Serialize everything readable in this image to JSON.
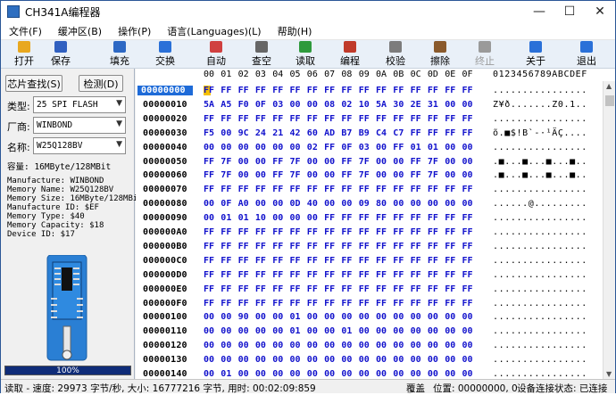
{
  "window": {
    "title": "CH341A编程器",
    "minimize": "—",
    "maximize": "☐",
    "close": "✕"
  },
  "menu": [
    "文件(F)",
    "缓冲区(B)",
    "操作(P)",
    "语言(Languages)(L)",
    "帮助(H)"
  ],
  "toolbar": [
    {
      "label": "打开",
      "icon": "open-folder-icon",
      "color": "#e8a820",
      "disabled": false
    },
    {
      "label": "保存",
      "icon": "save-disk-icon",
      "color": "#3060c0",
      "disabled": false
    },
    {
      "label": "填充",
      "icon": "fill-pen-icon",
      "color": "#2d68c4",
      "disabled": false
    },
    {
      "label": "交换",
      "icon": "swap-arrows-icon",
      "color": "#2a70d8",
      "disabled": false
    },
    {
      "label": "自动",
      "icon": "auto-run-icon",
      "color": "#d04040",
      "disabled": false
    },
    {
      "label": "查空",
      "icon": "blank-check-icon",
      "color": "#666666",
      "disabled": false
    },
    {
      "label": "读取",
      "icon": "read-chip-icon",
      "color": "#2e9a3c",
      "disabled": false
    },
    {
      "label": "编程",
      "icon": "program-chip-icon",
      "color": "#c03a2a",
      "disabled": false
    },
    {
      "label": "校验",
      "icon": "verify-icon",
      "color": "#7c7c7c",
      "disabled": false
    },
    {
      "label": "擦除",
      "icon": "erase-icon",
      "color": "#8a5a2c",
      "disabled": false
    },
    {
      "label": "终止",
      "icon": "stop-icon",
      "color": "#9a9a9a",
      "disabled": true
    },
    {
      "label": "关于",
      "icon": "about-info-icon",
      "color": "#2a70d8",
      "disabled": false
    },
    {
      "label": "退出",
      "icon": "exit-door-icon",
      "color": "#2a70d8",
      "disabled": false
    }
  ],
  "left": {
    "find_chip_label": "芯片查找(S)",
    "detect_label": "检测(D)",
    "type_label": "类型:",
    "type_value": "25 SPI FLASH",
    "vendor_label": "厂商:",
    "vendor_value": "WINBOND",
    "name_label": "名称:",
    "name_value": "W25Q128BV",
    "capacity_text": "容量: 16MByte/128MBit",
    "info_lines": [
      "Manufacture: WINBOND",
      "Memory Name: W25Q128BV",
      "Memory Size: 16MByte/128MBi",
      "Manufacture ID: $EF",
      "Memory Type: $40",
      "Memory Capacity: $18",
      "Device ID: $17"
    ],
    "progress_text": "100%",
    "progress_value": 1.0
  },
  "hex": {
    "header_cols": [
      "00",
      "01",
      "02",
      "03",
      "04",
      "05",
      "06",
      "07",
      "08",
      "09",
      "0A",
      "0B",
      "0C",
      "0D",
      "0E",
      "0F"
    ],
    "ascii_header": "0123456789ABCDEF",
    "rows": [
      {
        "addr": "00000000",
        "bytes": [
          "FF",
          "FF",
          "FF",
          "FF",
          "FF",
          "FF",
          "FF",
          "FF",
          "FF",
          "FF",
          "FF",
          "FF",
          "FF",
          "FF",
          "FF",
          "FF"
        ],
        "ascii": "................"
      },
      {
        "addr": "00000010",
        "bytes": [
          "5A",
          "A5",
          "F0",
          "0F",
          "03",
          "00",
          "00",
          "08",
          "02",
          "10",
          "5A",
          "30",
          "2E",
          "31",
          "00",
          "00"
        ],
        "ascii": "Z¥ð.......Z0.1.."
      },
      {
        "addr": "00000020",
        "bytes": [
          "FF",
          "FF",
          "FF",
          "FF",
          "FF",
          "FF",
          "FF",
          "FF",
          "FF",
          "FF",
          "FF",
          "FF",
          "FF",
          "FF",
          "FF",
          "FF"
        ],
        "ascii": "................"
      },
      {
        "addr": "00000030",
        "bytes": [
          "F5",
          "00",
          "9C",
          "24",
          "21",
          "42",
          "60",
          "AD",
          "B7",
          "B9",
          "C4",
          "C7",
          "FF",
          "FF",
          "FF",
          "FF"
        ],
        "ascii": "õ.■$!B`-·¹ÄÇ...."
      },
      {
        "addr": "00000040",
        "bytes": [
          "00",
          "00",
          "00",
          "00",
          "00",
          "00",
          "02",
          "FF",
          "0F",
          "03",
          "00",
          "FF",
          "01",
          "01",
          "00",
          "00"
        ],
        "ascii": "................"
      },
      {
        "addr": "00000050",
        "bytes": [
          "FF",
          "7F",
          "00",
          "00",
          "FF",
          "7F",
          "00",
          "00",
          "FF",
          "7F",
          "00",
          "00",
          "FF",
          "7F",
          "00",
          "00"
        ],
        "ascii": ".■...■...■...■.."
      },
      {
        "addr": "00000060",
        "bytes": [
          "FF",
          "7F",
          "00",
          "00",
          "FF",
          "7F",
          "00",
          "00",
          "FF",
          "7F",
          "00",
          "00",
          "FF",
          "7F",
          "00",
          "00"
        ],
        "ascii": ".■...■...■...■.."
      },
      {
        "addr": "00000070",
        "bytes": [
          "FF",
          "FF",
          "FF",
          "FF",
          "FF",
          "FF",
          "FF",
          "FF",
          "FF",
          "FF",
          "FF",
          "FF",
          "FF",
          "FF",
          "FF",
          "FF"
        ],
        "ascii": "................"
      },
      {
        "addr": "00000080",
        "bytes": [
          "00",
          "0F",
          "A0",
          "00",
          "00",
          "0D",
          "40",
          "00",
          "00",
          "09",
          "80",
          "00",
          "00",
          "00",
          "00",
          "00"
        ],
        "ascii": "......@........."
      },
      {
        "addr": "00000090",
        "bytes": [
          "00",
          "01",
          "01",
          "10",
          "00",
          "00",
          "00",
          "FF",
          "FF",
          "FF",
          "FF",
          "FF",
          "FF",
          "FF",
          "FF",
          "FF"
        ],
        "ascii": "................"
      },
      {
        "addr": "000000A0",
        "bytes": [
          "FF",
          "FF",
          "FF",
          "FF",
          "FF",
          "FF",
          "FF",
          "FF",
          "FF",
          "FF",
          "FF",
          "FF",
          "FF",
          "FF",
          "FF",
          "FF"
        ],
        "ascii": "................"
      },
      {
        "addr": "000000B0",
        "bytes": [
          "FF",
          "FF",
          "FF",
          "FF",
          "FF",
          "FF",
          "FF",
          "FF",
          "FF",
          "FF",
          "FF",
          "FF",
          "FF",
          "FF",
          "FF",
          "FF"
        ],
        "ascii": "................"
      },
      {
        "addr": "000000C0",
        "bytes": [
          "FF",
          "FF",
          "FF",
          "FF",
          "FF",
          "FF",
          "FF",
          "FF",
          "FF",
          "FF",
          "FF",
          "FF",
          "FF",
          "FF",
          "FF",
          "FF"
        ],
        "ascii": "................"
      },
      {
        "addr": "000000D0",
        "bytes": [
          "FF",
          "FF",
          "FF",
          "FF",
          "FF",
          "FF",
          "FF",
          "FF",
          "FF",
          "FF",
          "FF",
          "FF",
          "FF",
          "FF",
          "FF",
          "FF"
        ],
        "ascii": "................"
      },
      {
        "addr": "000000E0",
        "bytes": [
          "FF",
          "FF",
          "FF",
          "FF",
          "FF",
          "FF",
          "FF",
          "FF",
          "FF",
          "FF",
          "FF",
          "FF",
          "FF",
          "FF",
          "FF",
          "FF"
        ],
        "ascii": "................"
      },
      {
        "addr": "000000F0",
        "bytes": [
          "FF",
          "FF",
          "FF",
          "FF",
          "FF",
          "FF",
          "FF",
          "FF",
          "FF",
          "FF",
          "FF",
          "FF",
          "FF",
          "FF",
          "FF",
          "FF"
        ],
        "ascii": "................"
      },
      {
        "addr": "00000100",
        "bytes": [
          "00",
          "00",
          "90",
          "00",
          "00",
          "01",
          "00",
          "00",
          "00",
          "00",
          "00",
          "00",
          "00",
          "00",
          "00",
          "00"
        ],
        "ascii": "................"
      },
      {
        "addr": "00000110",
        "bytes": [
          "00",
          "00",
          "00",
          "00",
          "00",
          "01",
          "00",
          "00",
          "01",
          "00",
          "00",
          "00",
          "00",
          "00",
          "00",
          "00"
        ],
        "ascii": "................"
      },
      {
        "addr": "00000120",
        "bytes": [
          "00",
          "00",
          "00",
          "00",
          "00",
          "00",
          "00",
          "00",
          "00",
          "00",
          "00",
          "00",
          "00",
          "00",
          "00",
          "00"
        ],
        "ascii": "................"
      },
      {
        "addr": "00000130",
        "bytes": [
          "00",
          "00",
          "00",
          "00",
          "00",
          "00",
          "00",
          "00",
          "00",
          "00",
          "00",
          "00",
          "00",
          "00",
          "00",
          "00"
        ],
        "ascii": "................"
      },
      {
        "addr": "00000140",
        "bytes": [
          "00",
          "01",
          "00",
          "00",
          "00",
          "00",
          "00",
          "00",
          "00",
          "00",
          "00",
          "00",
          "00",
          "00",
          "00",
          "00"
        ],
        "ascii": "................"
      }
    ]
  },
  "status": {
    "left": "读取 - 速度: 29973 字节/秒, 大小: 16777216 字节, 用时: 00:02:09:859",
    "mode": "覆盖",
    "position": "位置: 00000000, 0",
    "device_state": "设备连接状态: 已连接"
  }
}
